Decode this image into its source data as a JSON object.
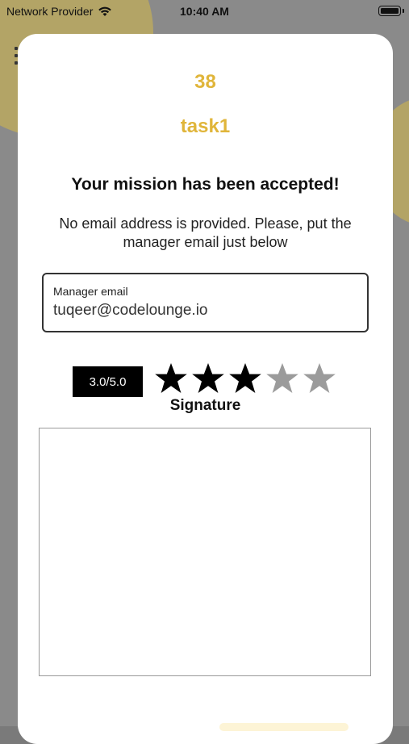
{
  "status_bar": {
    "carrier": "Network Provider",
    "time": "10:40 AM"
  },
  "modal": {
    "task_number": "38",
    "task_name": "task1",
    "heading": "Your mission has been accepted!",
    "info_text": "No email address is provided. Please, put the manager email just below",
    "email_field": {
      "label": "Manager email",
      "value": "tuqeer@codelounge.io"
    },
    "rating": {
      "label": "3.0/5.0",
      "value": 3.0,
      "max": 5
    },
    "signature_label": "Signature"
  },
  "colors": {
    "accent": "#e0b53a",
    "star_filled": "#000000",
    "star_empty": "#9b9b9b",
    "badge_bg": "#000000"
  },
  "icons": [
    "wifi-icon",
    "battery-icon",
    "star-icon",
    "menu-icon"
  ]
}
